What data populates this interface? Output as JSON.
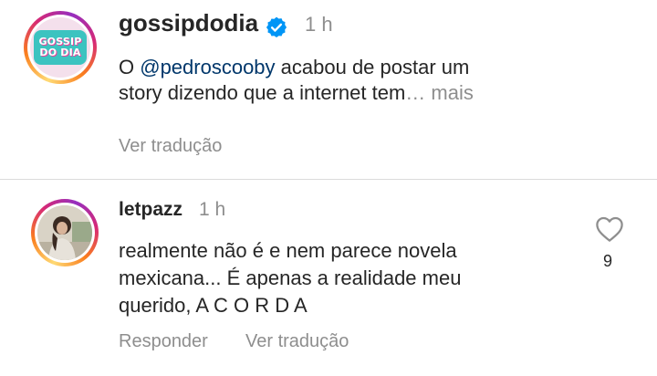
{
  "post": {
    "username": "gossipdodia",
    "verified": true,
    "time": "1 h",
    "avatar": {
      "line1": "GOSSIP",
      "line2": "DO DIA"
    },
    "text_prefix": "O ",
    "mention": "@pedroscooby",
    "text_line1_rest": " acabou de postar um",
    "text_line2": "story dizendo que a internet tem",
    "ellipsis": "…",
    "more": " mais",
    "translate": "Ver tradução"
  },
  "comment": {
    "username": "letpazz",
    "time": "1 h",
    "text_line1": "realmente não é e nem parece novela",
    "text_line2": "mexicana... É apenas a realidade meu",
    "text_line3": "querido, A C O R D A",
    "reply": "Responder",
    "translate": "Ver tradução",
    "like_count": "9"
  },
  "icons": {
    "verified": "verified-badge-icon",
    "like": "heart-outline-icon"
  },
  "colors": {
    "verified_blue": "#0095f6",
    "secondary_text": "#8e8e8e",
    "mention": "#00376b"
  }
}
